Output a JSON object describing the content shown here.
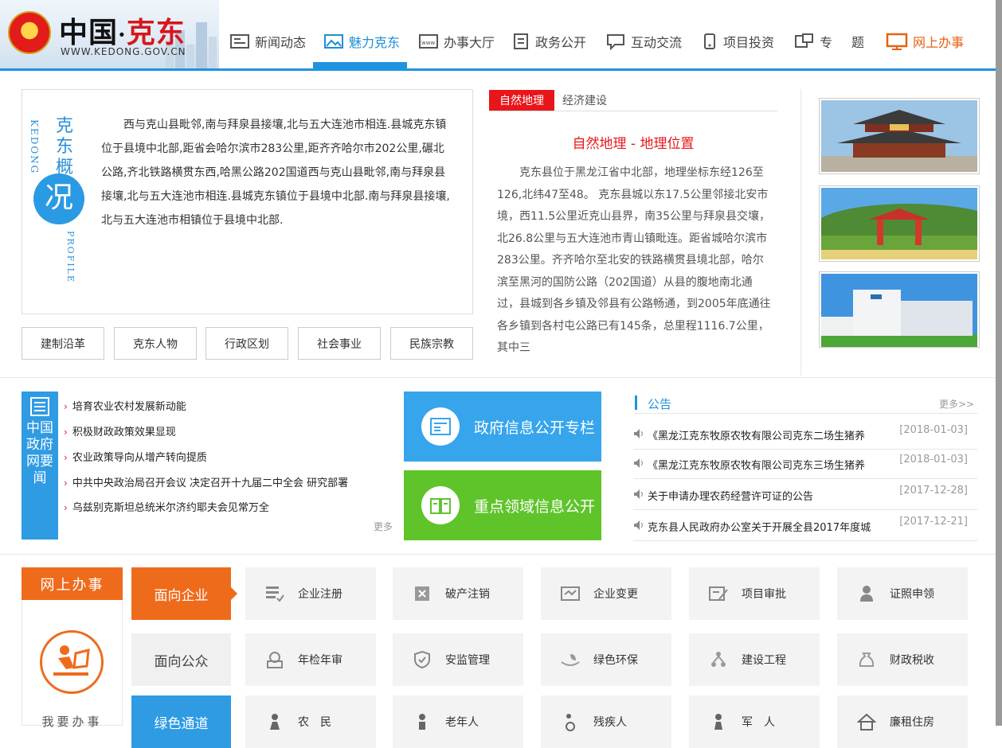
{
  "header": {
    "site_title_cn": "中国",
    "site_title_dot": "·",
    "site_title_place": "克东",
    "site_url": "WWW.KEDONG.GOV.CN",
    "nav": [
      {
        "label": "新闻动态",
        "icon": "news-icon"
      },
      {
        "label": "魅力克东",
        "icon": "picture-icon",
        "active": true
      },
      {
        "label": "办事大厅",
        "icon": "www-icon"
      },
      {
        "label": "政务公开",
        "icon": "document-icon"
      },
      {
        "label": "互动交流",
        "icon": "chat-icon"
      },
      {
        "label": "项目投资",
        "icon": "phone-icon"
      },
      {
        "label": "专　题",
        "icon": "topic-icon"
      },
      {
        "label": "网上办事",
        "icon": "monitor-icon"
      }
    ]
  },
  "profile": {
    "tag_cn": "克东概",
    "tag_circle": "况",
    "tag_en_1": "KEDONG",
    "tag_en_2": "PROFILE",
    "text": "西与克山县毗邻,南与拜泉县接壤,北与五大连池市相连.县城克东镇位于县境中北部,距省会哈尔滨市283公里,距齐齐哈尔市202公里,碾北公路,齐北铁路横贯东西,哈黑公路202国道西与克山县毗邻,南与拜泉县接壤,北与五大连池市相连.县城克东镇位于县境中北部.南与拜泉县接壤,北与五大连池市相镇位于县境中北部.",
    "buttons": [
      "建制沿革",
      "克东人物",
      "行政区划",
      "社会事业",
      "民族宗教"
    ]
  },
  "intro": {
    "tabs": [
      "自然地理",
      "经济建设"
    ],
    "title": "自然地理 - 地理位置",
    "body": "克东县位于黑龙江省中北部，地理坐标东经126至126,北纬47至48。 克东县城以东17.5公里邻接北安市境，西11.5公里近克山县界，南35公里与拜泉县交壤，北26.8公里与五大连池市青山镇毗连。距省城哈尔滨市283公里。齐齐哈尔至北安的铁路横贯县境北部，哈尔滨至黑河的国防公路（202国道）从县的腹地南北通过，县城到各乡镇及邻县有公路畅通，到2005年底通往各乡镇到各村屯公路已有145条，总里程1116.7公里，其中三"
  },
  "news": {
    "side_label": "中国政府网要闻",
    "items": [
      "培育农业农村发展新动能",
      "积极财政政策效果显现",
      "农业政策导向从增产转向提质",
      "中共中央政治局召开会议 决定召开十九届二中全会 研究部署",
      "乌兹别克斯坦总统米尔济约耶夫会见常万全"
    ],
    "more": "更多"
  },
  "big_buttons": [
    {
      "label": "政府信息公开专栏",
      "color": "#36a5ec"
    },
    {
      "label": "重点领域信息公开",
      "color": "#5fc42a"
    }
  ],
  "notice": {
    "title": "公告",
    "more": "更多>>",
    "items": [
      {
        "title": "《黑龙江克东牧原农牧有限公司克东二场生猪养",
        "date": "[2018-01-03]"
      },
      {
        "title": "《黑龙江克东牧原农牧有限公司克东三场生猪养",
        "date": "[2018-01-03]"
      },
      {
        "title": "关于申请办理农药经营许可证的公告",
        "date": "[2017-12-28]"
      },
      {
        "title": "克东县人民政府办公室关于开展全县2017年度城",
        "date": "[2017-12-21]"
      }
    ]
  },
  "online": {
    "head": "网上办事",
    "label": "我要办事",
    "categories": [
      "面向企业",
      "面向公众",
      "绿色通道"
    ],
    "row1": [
      "企业注册",
      "破产注销",
      "企业变更",
      "项目审批",
      "证照申领"
    ],
    "row2": [
      "年检年审",
      "安监管理",
      "绿色环保",
      "建设工程",
      "财政税收"
    ],
    "row3": [
      "农　民",
      "老年人",
      "残疾人",
      "军　人",
      "廉租住房"
    ]
  },
  "colors": {
    "blue": "#1e93e0",
    "red": "#e8161b",
    "orange": "#ef6b1c",
    "green": "#5fc42a"
  }
}
